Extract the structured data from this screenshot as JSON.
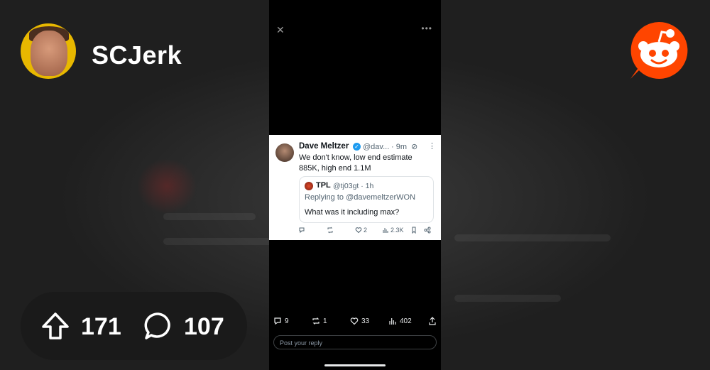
{
  "community": {
    "name": "SCJerk",
    "avatar_icon": "user-avatar",
    "brand_logo_icon": "reddit-snoo-icon",
    "brand_color": "#ff4500"
  },
  "tweet": {
    "name": "Dave Meltzer",
    "handle": "@dav...",
    "time": "· 9m",
    "text": "We don't know, low end estimate 885K, high end 1.1M",
    "quote": {
      "name": "TPL",
      "handle": "@tj03gt · 1h",
      "replying": "Replying to @davemeltzerWON",
      "text": "What was it including max?"
    },
    "actions": {
      "likes": "2",
      "views": "2.3K"
    }
  },
  "phone_actions": {
    "replies": "9",
    "reposts": "1",
    "likes": "33",
    "views": "402"
  },
  "reply_placeholder": "Post your reply",
  "stats": {
    "upvotes": "171",
    "comments": "107"
  }
}
